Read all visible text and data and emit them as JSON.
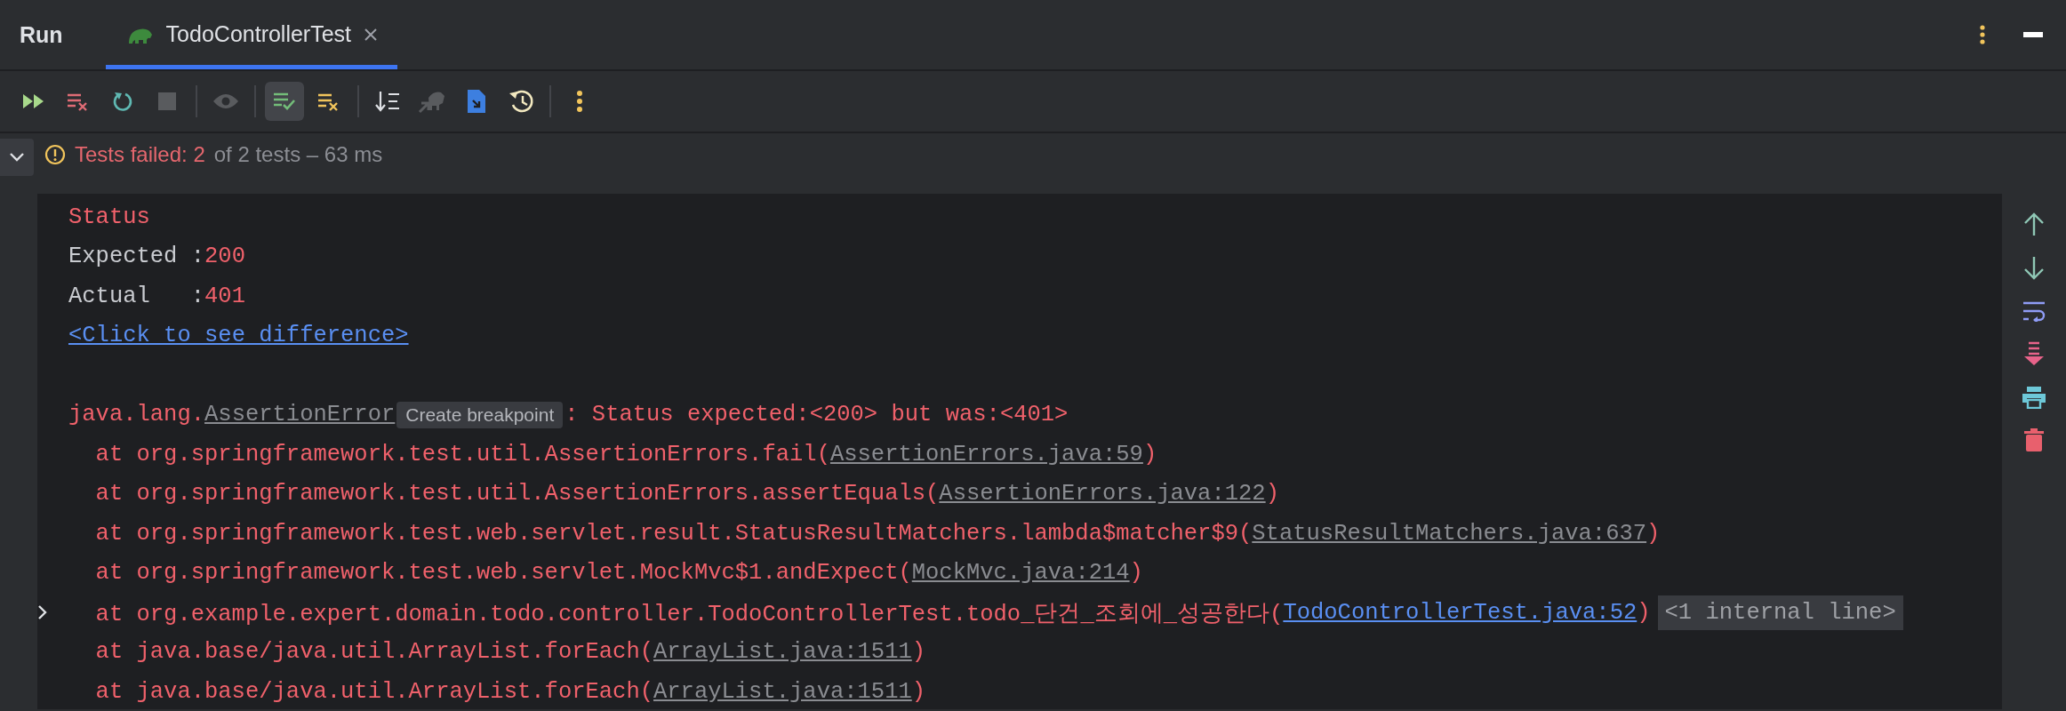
{
  "panel_title": "Run",
  "tabs": [
    {
      "label": "TodoControllerTest",
      "selected": true
    }
  ],
  "toolbar_groups": [
    {
      "buttons": [
        {
          "kind": "rerun",
          "selected": false,
          "disabled": false
        },
        {
          "kind": "rerun-failed",
          "selected": false,
          "disabled": false
        },
        {
          "kind": "toggle-auto",
          "selected": false,
          "disabled": false
        },
        {
          "kind": "stop",
          "selected": false,
          "disabled": true
        }
      ]
    },
    {
      "buttons": [
        {
          "kind": "eye",
          "selected": false,
          "disabled": true
        }
      ]
    },
    {
      "buttons": [
        {
          "kind": "show-passed",
          "selected": true,
          "disabled": false
        },
        {
          "kind": "show-ignored",
          "selected": false,
          "disabled": false
        }
      ]
    },
    {
      "buttons": [
        {
          "kind": "sort",
          "selected": false,
          "disabled": false
        },
        {
          "kind": "import",
          "selected": false,
          "disabled": true
        },
        {
          "kind": "export",
          "selected": false,
          "disabled": false
        },
        {
          "kind": "history",
          "selected": false,
          "disabled": false
        }
      ]
    },
    {
      "buttons": [
        {
          "kind": "more",
          "selected": false,
          "disabled": false
        }
      ]
    }
  ],
  "status": {
    "failed": "Tests failed: 2",
    "summary": "of 2 tests – 63 ms",
    "expanded": true
  },
  "console_lines": [
    {
      "kind": "message",
      "expandable": false,
      "segments": [
        {
          "kind": "error",
          "text": "Status"
        }
      ]
    },
    {
      "kind": "message",
      "expandable": false,
      "segments": [
        {
          "kind": "plain",
          "text": "Expected :"
        },
        {
          "kind": "error",
          "text": "200"
        }
      ]
    },
    {
      "kind": "message",
      "expandable": false,
      "segments": [
        {
          "kind": "plain",
          "text": "Actual   :"
        },
        {
          "kind": "error",
          "text": "401"
        }
      ]
    },
    {
      "kind": "message",
      "expandable": false,
      "segments": [
        {
          "kind": "link",
          "text": "<Click to see difference>"
        }
      ]
    },
    {
      "kind": "blank"
    },
    {
      "kind": "message",
      "expandable": false,
      "segments": [
        {
          "kind": "error",
          "text": "java.lang."
        },
        {
          "kind": "source",
          "text": "AssertionError"
        },
        {
          "kind": "hint",
          "text": "Create breakpoint"
        },
        {
          "kind": "error",
          "text": ": Status expected:<200> but was:<401>"
        }
      ]
    },
    {
      "kind": "frame",
      "expandable": false,
      "segments": [
        {
          "kind": "error",
          "text": "at org.springframework.test.util.AssertionErrors.fail("
        },
        {
          "kind": "source",
          "text": "AssertionErrors.java:59"
        },
        {
          "kind": "error",
          "text": ")"
        }
      ]
    },
    {
      "kind": "frame",
      "expandable": false,
      "segments": [
        {
          "kind": "error",
          "text": "at org.springframework.test.util.AssertionErrors.assertEquals("
        },
        {
          "kind": "source",
          "text": "AssertionErrors.java:122"
        },
        {
          "kind": "error",
          "text": ")"
        }
      ]
    },
    {
      "kind": "frame",
      "expandable": false,
      "segments": [
        {
          "kind": "error",
          "text": "at org.springframework.test.web.servlet.result.StatusResultMatchers.lambda$matcher$9("
        },
        {
          "kind": "source",
          "text": "StatusResultMatchers.java:637"
        },
        {
          "kind": "error",
          "text": ")"
        }
      ]
    },
    {
      "kind": "frame",
      "expandable": false,
      "segments": [
        {
          "kind": "error",
          "text": "at org.springframework.test.web.servlet.MockMvc$1.andExpect("
        },
        {
          "kind": "source",
          "text": "MockMvc.java:214"
        },
        {
          "kind": "error",
          "text": ")"
        }
      ]
    },
    {
      "kind": "frame",
      "expandable": true,
      "segments": [
        {
          "kind": "error",
          "text": "at org.example.expert.domain.todo.controller.TodoControllerTest.todo_단건_조회에_성공한다("
        },
        {
          "kind": "link",
          "text": "TodoControllerTest.java:52"
        },
        {
          "kind": "error",
          "text": ")"
        },
        {
          "kind": "folded",
          "text": "<1 internal line>"
        }
      ]
    },
    {
      "kind": "frame",
      "expandable": false,
      "segments": [
        {
          "kind": "error",
          "text": "at java.base/java.util.ArrayList.forEach("
        },
        {
          "kind": "source",
          "text": "ArrayList.java:1511"
        },
        {
          "kind": "error",
          "text": ")"
        }
      ]
    },
    {
      "kind": "frame",
      "expandable": false,
      "segments": [
        {
          "kind": "error",
          "text": "at java.base/java.util.ArrayList.forEach("
        },
        {
          "kind": "source",
          "text": "ArrayList.java:1511"
        },
        {
          "kind": "error",
          "text": ")"
        }
      ]
    }
  ]
}
